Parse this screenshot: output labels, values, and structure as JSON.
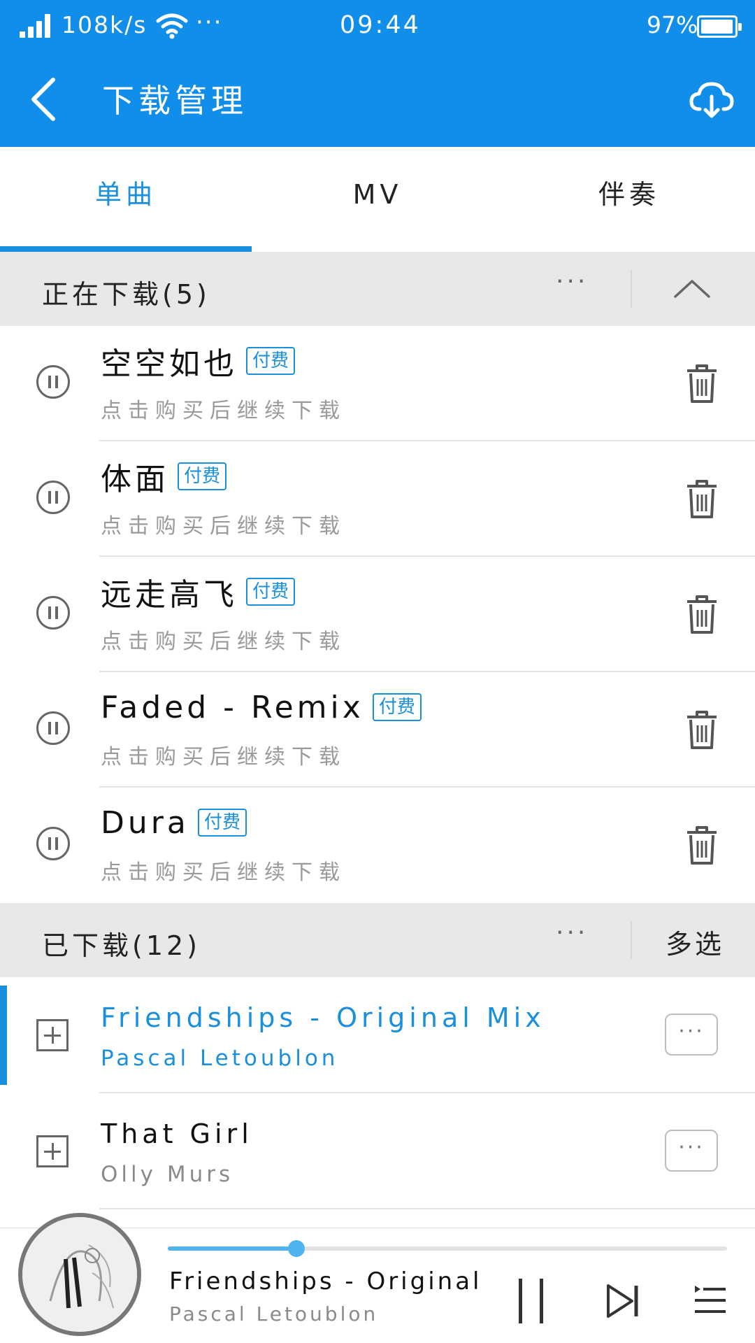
{
  "status_bar": {
    "net_speed": "108k/s",
    "more": "···",
    "time": "09:44",
    "battery": "97%",
    "battery_level": 0.97
  },
  "header": {
    "title": "下载管理",
    "back_icon": "chevron-left-icon",
    "download_icon": "cloud-download-icon"
  },
  "tabs": [
    {
      "label": "单曲",
      "active": true
    },
    {
      "label": "MV",
      "active": false
    },
    {
      "label": "伴奏",
      "active": false
    }
  ],
  "downloading": {
    "title": "正在下载(5)",
    "more": "···",
    "collapse_icon": "chevron-up-icon",
    "badge": "付费",
    "items": [
      {
        "title": "空空如也",
        "badge": "付费",
        "status": "点击购买后继续下载"
      },
      {
        "title": "体面",
        "badge": "付费",
        "status": "点击购买后继续下载"
      },
      {
        "title": "远走高飞",
        "badge": "付费",
        "status": "点击购买后继续下载"
      },
      {
        "title": "Faded - Remix",
        "badge": "付费",
        "status": "点击购买后继续下载"
      },
      {
        "title": "Dura",
        "badge": "付费",
        "status": "点击购买后继续下载"
      }
    ]
  },
  "downloaded": {
    "title": "已下载(12)",
    "more": "···",
    "multi_select": "多选",
    "items": [
      {
        "title": "Friendships - Original Mix",
        "artist": "Pascal Letoublon",
        "playing": true
      },
      {
        "title": "That Girl",
        "artist": "Olly Murs",
        "playing": false
      }
    ],
    "row_more": "···"
  },
  "player": {
    "title": "Friendships - Original …",
    "artist": "Pascal Letoublon",
    "progress": 0.23,
    "accent": "#1a8fdd"
  },
  "colors": {
    "header_bg": "#108ee9",
    "accent": "#1a8fdd",
    "section_bg": "#e8e8e8"
  }
}
